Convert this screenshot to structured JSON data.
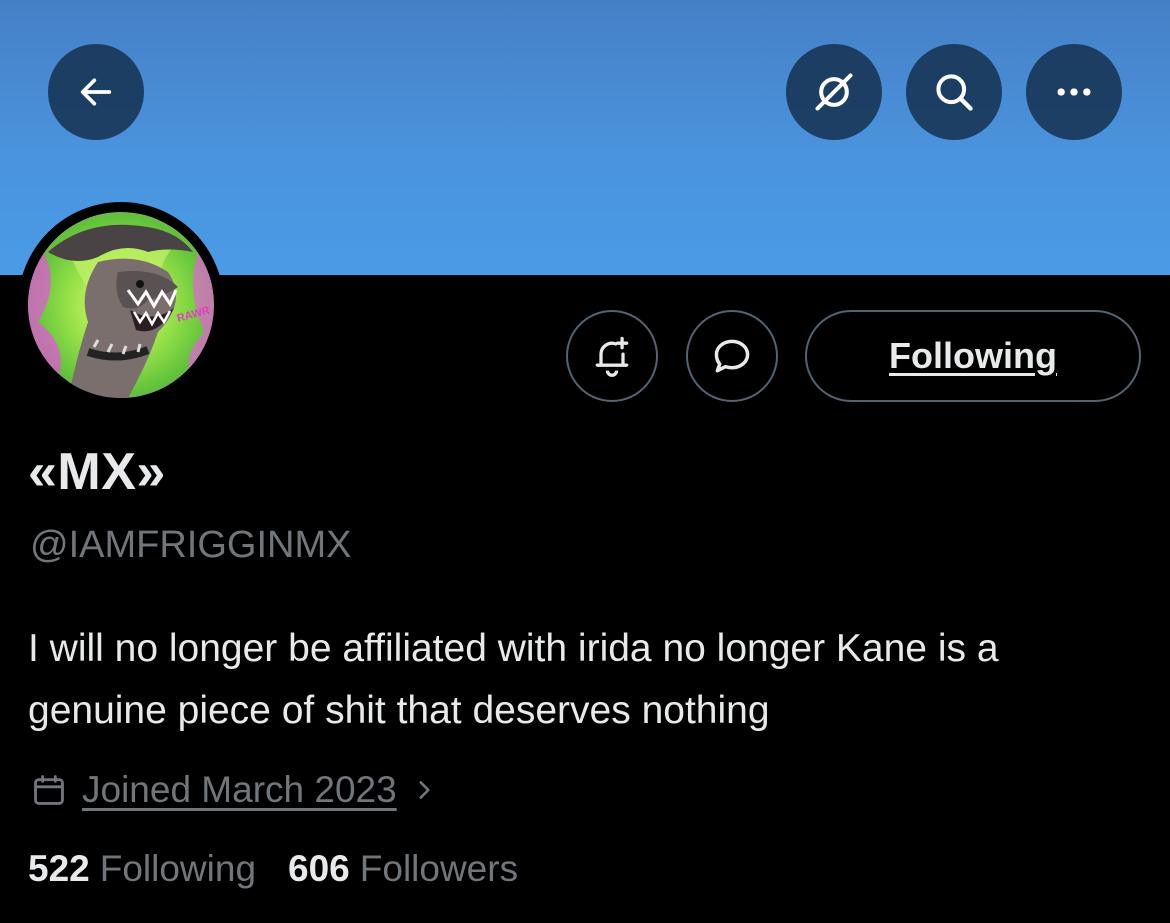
{
  "header": {
    "back_icon": "arrow-left-icon",
    "grok_icon": "grok-icon",
    "search_icon": "search-icon",
    "more_icon": "more-horizontal-icon",
    "banner_color": "#4a93dd"
  },
  "profile": {
    "avatar_icon": "avatar-image",
    "avatar_text": "RAWR",
    "display_name": "«MX»",
    "handle": "@IAMFRIGGINMX",
    "bio": "I will no longer be affiliated with irida no longer Kane is a genuine piece of shit that deserves nothing",
    "joined": "Joined March 2023"
  },
  "actions": {
    "notify_icon": "bell-plus-icon",
    "message_icon": "message-bubble-icon",
    "following_label": "Following"
  },
  "stats": {
    "following_count": "522",
    "following_label": "Following",
    "followers_count": "606",
    "followers_label": "Followers"
  }
}
